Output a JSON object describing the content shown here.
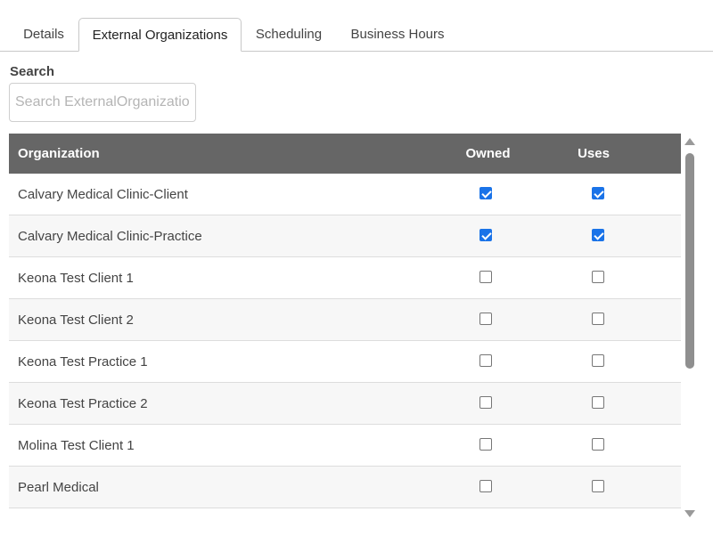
{
  "tabs": [
    {
      "label": "Details",
      "active": false
    },
    {
      "label": "External Organizations",
      "active": true
    },
    {
      "label": "Scheduling",
      "active": false
    },
    {
      "label": "Business Hours",
      "active": false
    }
  ],
  "search": {
    "label": "Search",
    "placeholder": "Search ExternalOrganizations",
    "value": ""
  },
  "table": {
    "columns": [
      "Organization",
      "Owned",
      "Uses"
    ],
    "rows": [
      {
        "name": "Calvary Medical Clinic-Client",
        "owned": true,
        "uses": true
      },
      {
        "name": "Calvary Medical Clinic-Practice",
        "owned": true,
        "uses": true
      },
      {
        "name": "Keona Test Client 1",
        "owned": false,
        "uses": false
      },
      {
        "name": "Keona Test Client 2",
        "owned": false,
        "uses": false
      },
      {
        "name": "Keona Test Practice 1",
        "owned": false,
        "uses": false
      },
      {
        "name": "Keona Test Practice 2",
        "owned": false,
        "uses": false
      },
      {
        "name": "Molina Test Client 1",
        "owned": false,
        "uses": false
      },
      {
        "name": "Pearl Medical",
        "owned": false,
        "uses": false
      },
      {
        "name": "",
        "owned": false,
        "uses": false
      }
    ]
  },
  "colors": {
    "header_bg": "#666666",
    "checkbox_accent": "#1a73e8",
    "row_alt": "#f7f7f7"
  },
  "icons": {
    "scroll_up": "triangle-up-icon",
    "scroll_down": "triangle-down-icon"
  }
}
